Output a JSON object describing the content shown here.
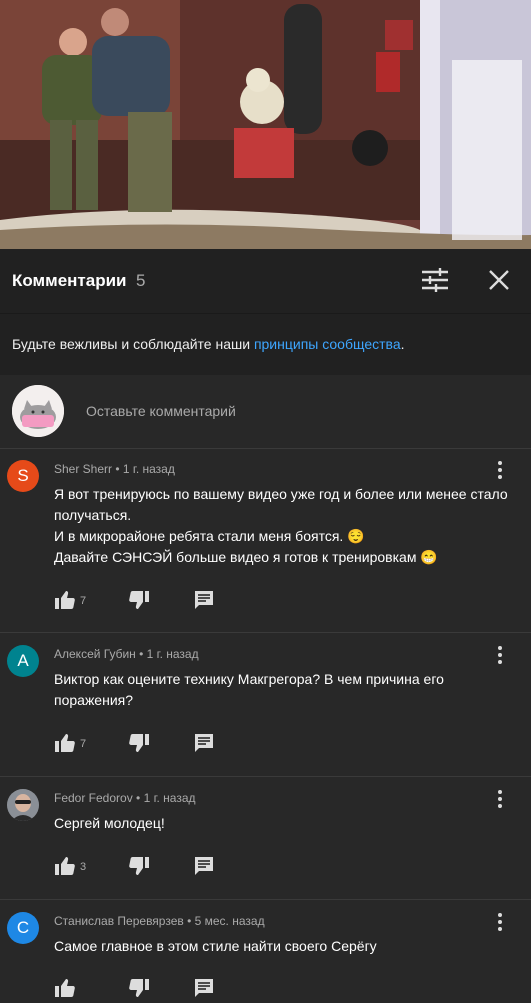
{
  "header": {
    "title": "Комментарии",
    "count": "5"
  },
  "guidelines": {
    "text_before": "Будьте вежливы и соблюдайте наши ",
    "link": "принципы сообщества",
    "text_after": "."
  },
  "composer": {
    "placeholder": "Оставьте комментарий"
  },
  "comments": [
    {
      "avatar_letter": "S",
      "avatar_color": "#e64a19",
      "author_meta": "Sher Sherr • 1 г. назад",
      "text": "Я вот тренируюсь по вашему видео уже год и более или менее  стало получаться.\nИ в микрорайоне ребята стали меня боятся. 😌\nДавайте СЭНСЭЙ больше видео я готов к тренировкам 😁",
      "likes": "7"
    },
    {
      "avatar_letter": "А",
      "avatar_color": "#00838f",
      "author_meta": "Алексей Губин • 1 г. назад",
      "text": "Виктор как оцените технику Макгрегора? В чем причина его поражения?",
      "likes": "7"
    },
    {
      "avatar_letter": "",
      "avatar_color": "#555555",
      "author_meta": "Fedor Fedorov • 1 г. назад",
      "text": "Сергей молодец!",
      "likes": "3"
    },
    {
      "avatar_letter": "С",
      "avatar_color": "#1e88e5",
      "author_meta": "Станислав Перевярзев • 5 мес. назад",
      "text": "Самое главное в этом стиле найти своего Серёгу",
      "likes": ""
    }
  ]
}
